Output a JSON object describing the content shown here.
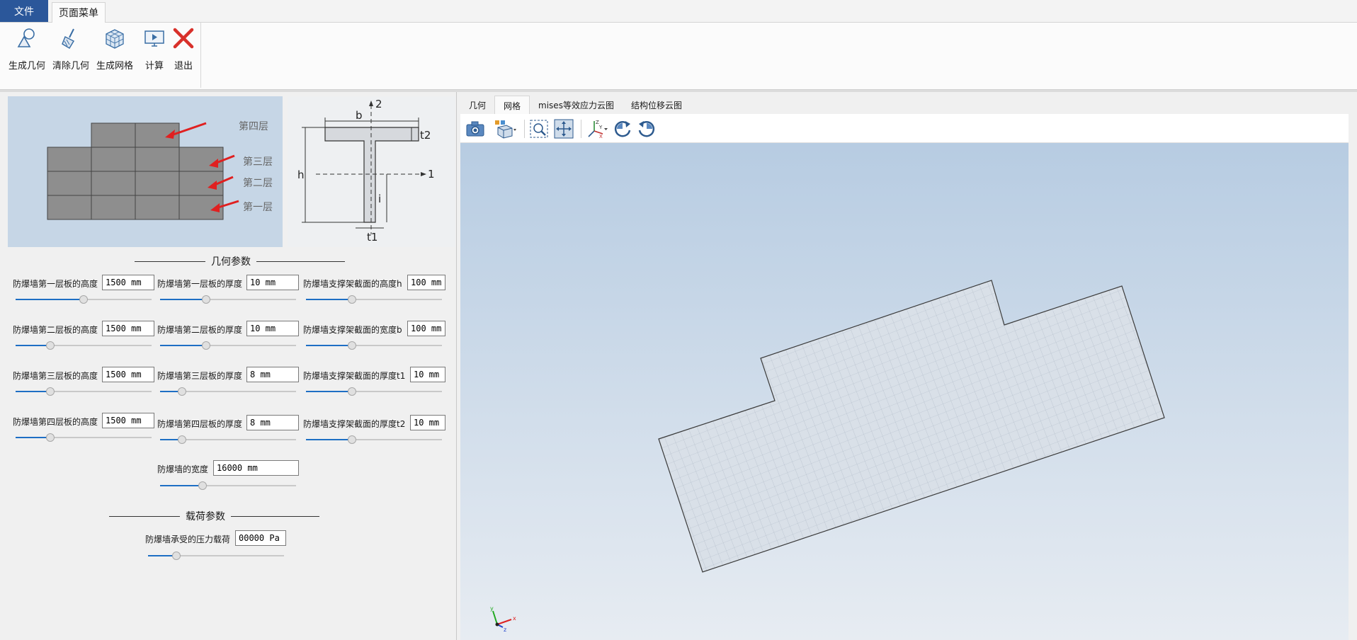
{
  "ribbon": {
    "tabs": [
      "文件",
      "页面菜单"
    ],
    "buttons": [
      {
        "label": "生成几何",
        "icon": "geometry-icon"
      },
      {
        "label": "清除几何",
        "icon": "broom-icon"
      },
      {
        "label": "生成网格",
        "icon": "mesh-cube-icon"
      },
      {
        "label": "计算",
        "icon": "compute-monitor-icon"
      },
      {
        "label": "退出",
        "icon": "close-x-icon"
      }
    ]
  },
  "diagram": {
    "layers": [
      "第四层",
      "第三层",
      "第二层",
      "第一层"
    ],
    "section_labels": {
      "axis2": "2",
      "axis1": "1",
      "b": "b",
      "t2": "t2",
      "h": "h",
      "i": "i",
      "t1": "t1"
    }
  },
  "geometry": {
    "title": "几何参数",
    "params": [
      {
        "label": "防爆墙第一层板的高度",
        "value": "1500 mm",
        "slider": 0.5
      },
      {
        "label": "防爆墙第一层板的厚度",
        "value": "10 mm",
        "slider": 0.33
      },
      {
        "label": "防爆墙支撑架截面的高度h",
        "value": "100 mm",
        "slider": 0.33
      },
      {
        "label": "防爆墙第二层板的高度",
        "value": "1500 mm",
        "slider": 0.24
      },
      {
        "label": "防爆墙第二层板的厚度",
        "value": "10 mm",
        "slider": 0.33
      },
      {
        "label": "防爆墙支撑架截面的宽度b",
        "value": "100 mm",
        "slider": 0.33
      },
      {
        "label": "防爆墙第三层板的高度",
        "value": "1500 mm",
        "slider": 0.24
      },
      {
        "label": "防爆墙第三层板的厚度",
        "value": "8 mm",
        "slider": 0.14
      },
      {
        "label": "防爆墙支撑架截面的厚度t1",
        "value": "10 mm",
        "slider": 0.33
      },
      {
        "label": "防爆墙第四层板的高度",
        "value": "1500 mm",
        "slider": 0.24
      },
      {
        "label": "防爆墙第四层板的厚度",
        "value": "8 mm",
        "slider": 0.14
      },
      {
        "label": "防爆墙支撑架截面的厚度t2",
        "value": "10 mm",
        "slider": 0.33
      }
    ],
    "width": {
      "label": "防爆墙的宽度",
      "value": "16000 mm",
      "slider": 0.3
    }
  },
  "load": {
    "title": "载荷参数",
    "pressure": {
      "label": "防爆墙承受的压力载荷",
      "value": "00000 Pa",
      "slider": 0.19
    }
  },
  "viewer": {
    "tabs": [
      "几何",
      "网格",
      "mises等效应力云图",
      "结构位移云图"
    ],
    "active_tab": 1,
    "toolbar": [
      "camera-icon",
      "display-mode-icon",
      "zoom-box-icon",
      "fit-all-icon",
      "axis-orient-icon",
      "rotate-left-icon",
      "rotate-right-icon"
    ],
    "axes": {
      "x": "x",
      "y": "y",
      "z": "z"
    }
  }
}
